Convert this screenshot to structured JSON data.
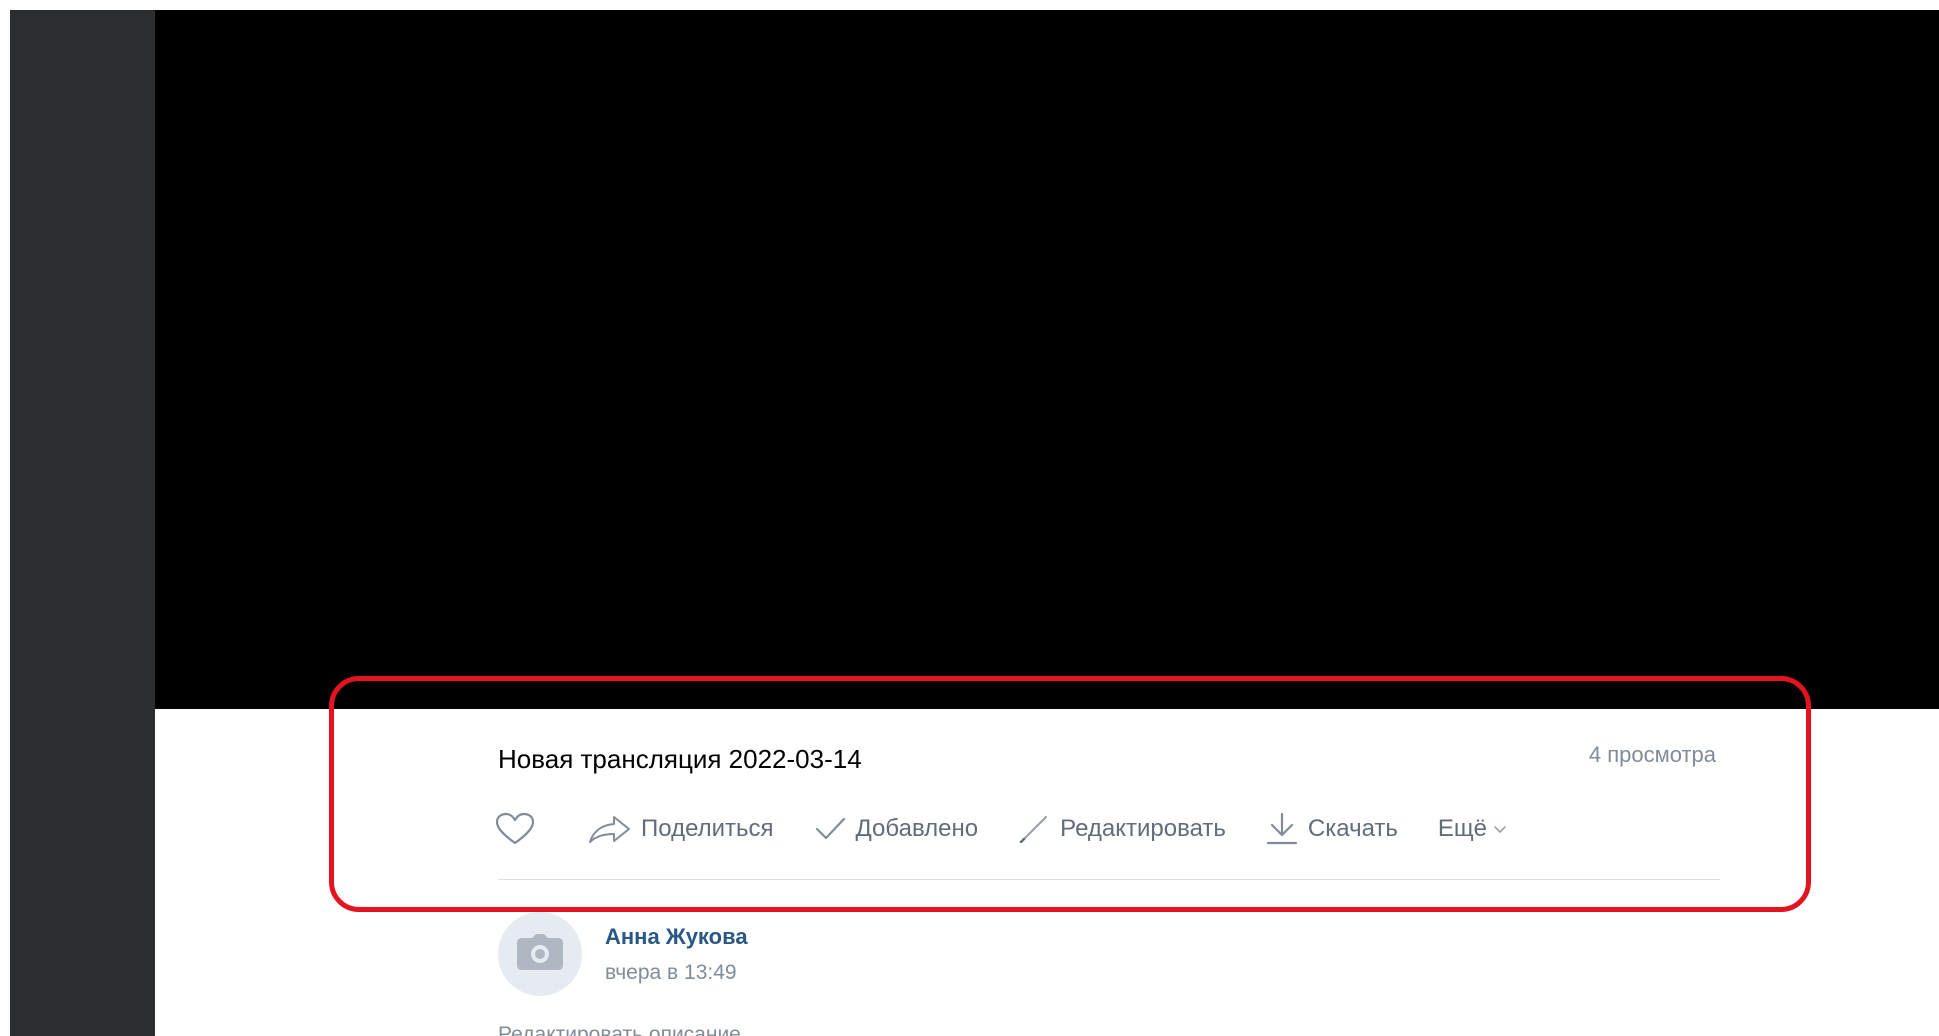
{
  "video": {
    "title": "Новая трансляция 2022-03-14",
    "views": "4 просмотра"
  },
  "actions": {
    "share_label": "Поделиться",
    "added_label": "Добавлено",
    "edit_label": "Редактировать",
    "download_label": "Скачать",
    "more_label": "Ещё"
  },
  "icons": {
    "like": "heart-icon",
    "share": "share-arrow-icon",
    "added": "checkmark-icon",
    "edit": "pencil-icon",
    "download": "download-icon",
    "more": "chevron-down-icon",
    "avatar": "camera-icon"
  },
  "author": {
    "name": "Анна Жукова",
    "time": "вчера в 13:49"
  },
  "description": {
    "edit_label": "Редактировать описание"
  },
  "colors": {
    "highlight": "#e3141f",
    "link": "#2a5885",
    "secondary_text": "#818c99",
    "action_text": "#626d7a"
  }
}
